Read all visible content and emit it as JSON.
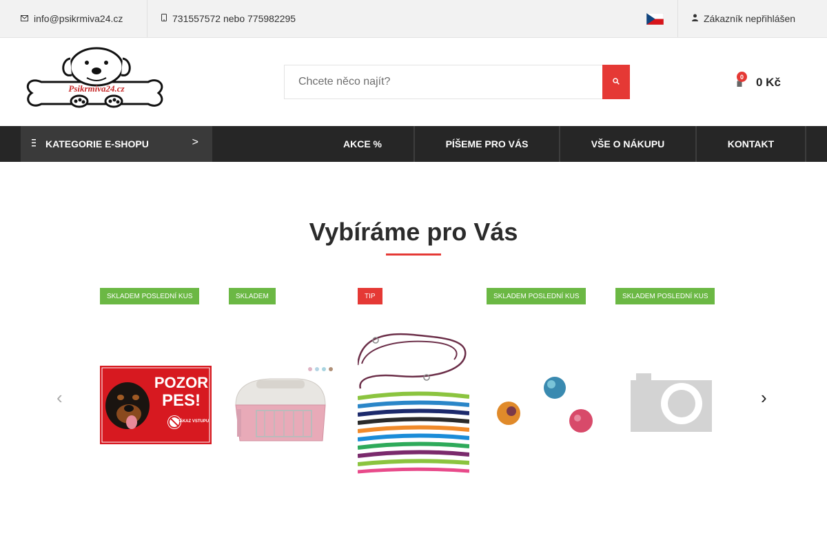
{
  "topbar": {
    "email": "info@psikrmiva24.cz",
    "email_icon": "envelope-icon",
    "phone": "731557572 nebo 775982295",
    "phone_icon": "phone-icon",
    "language_flag": "czech-flag",
    "user_icon": "user-icon",
    "user_status": "Zákazník nepřihlášen"
  },
  "header": {
    "logo_text": "Psikrmiva24.cz",
    "search_placeholder": "Chcete něco najít?",
    "cart_count": "0",
    "cart_total": "0 Kč"
  },
  "nav": {
    "categories_label": "KATEGORIE E-SHOPU",
    "categories_arrow": ">",
    "items": [
      "AKCE %",
      "PÍŠEME PRO VÁS",
      "VŠE O NÁKUPU",
      "KONTAKT"
    ]
  },
  "section": {
    "title": "Vybíráme pro Vás"
  },
  "carousel": {
    "prev_label": "‹",
    "next_label": "›",
    "products": [
      {
        "badge": "SKLADEM POSLEDNÍ KUS",
        "image": "pozor-pes-sign",
        "sign_line1": "POZOR",
        "sign_line2": "PES!",
        "sign_small": "ZÁKAZ VSTUPU!"
      },
      {
        "badge": "SKLADEM",
        "image": "pet-carrier"
      },
      {
        "badge": "TIP",
        "image": "rope-leashes"
      },
      {
        "badge": "SKLADEM POSLEDNÍ KUS",
        "image": "rubber-balls"
      },
      {
        "badge": "SKLADEM POSLEDNÍ KUS",
        "image": "no-photo-placeholder"
      }
    ]
  },
  "colors": {
    "accent": "#e53935",
    "badge_green": "#6bb844",
    "nav_dark": "#262626"
  }
}
